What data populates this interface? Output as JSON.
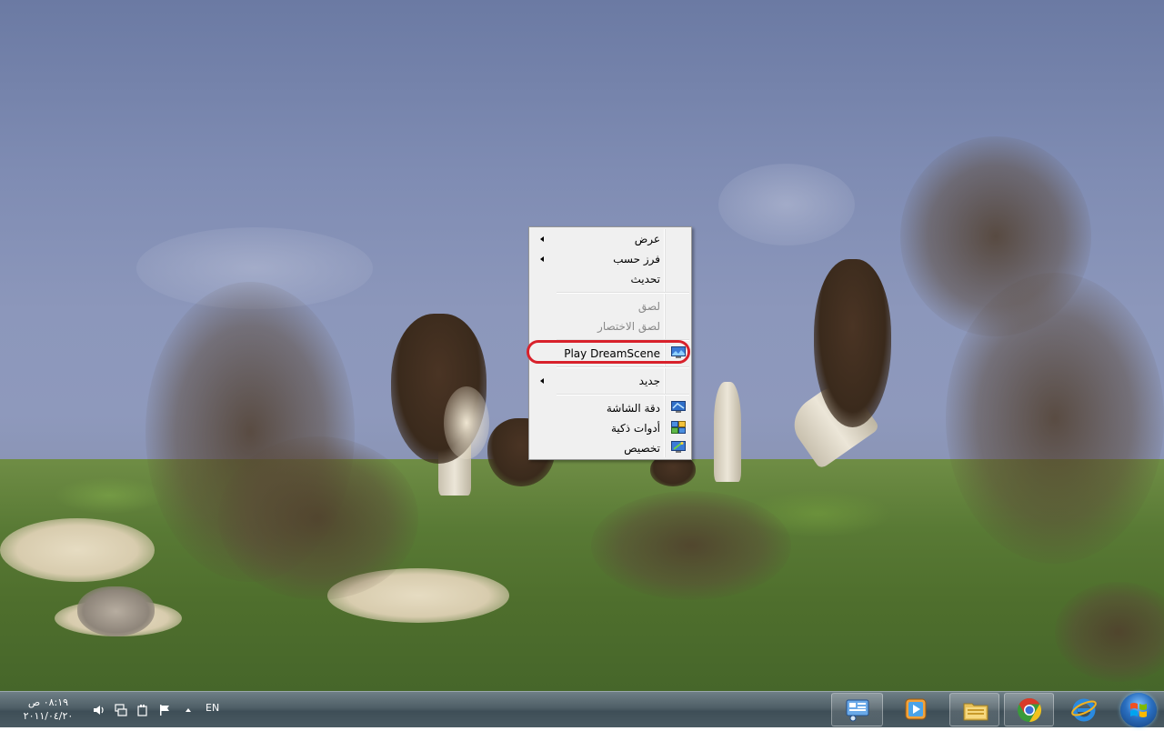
{
  "context_menu": {
    "items": [
      {
        "label": "عرض",
        "submenu": true
      },
      {
        "label": "فرز حسب",
        "submenu": true
      },
      {
        "label": "تحديث"
      },
      {
        "label": "لصق",
        "disabled": true
      },
      {
        "label": "لصق الاختصار",
        "disabled": true
      },
      {
        "label": "Play DreamScene",
        "icon": "dreamscene-icon",
        "highlighted": true
      },
      {
        "label": "جديد",
        "submenu": true
      },
      {
        "label": "دقة الشاشة",
        "icon": "display-icon"
      },
      {
        "label": "أدوات ذكية",
        "icon": "gadgets-icon"
      },
      {
        "label": "تخصيص",
        "icon": "personalize-icon"
      }
    ]
  },
  "taskbar": {
    "clock": {
      "time": "٠٨:١٩ ص",
      "date": "٢٠١١/٠٤/٢٠"
    },
    "language": "EN",
    "tray_icons": [
      "volume-icon",
      "network-icon",
      "power-icon",
      "action-center-flag-icon",
      "show-hidden-icons-arrow"
    ],
    "pinned_apps": [
      "control-panel-icon",
      "media-player-icon",
      "explorer-icon",
      "chrome-icon",
      "ie-icon"
    ],
    "start": "windows-start-orb"
  },
  "colors": {
    "menu_bg": "#f0f0f0",
    "highlight_ring": "#d8212b",
    "taskbar": "#4e5e66"
  }
}
